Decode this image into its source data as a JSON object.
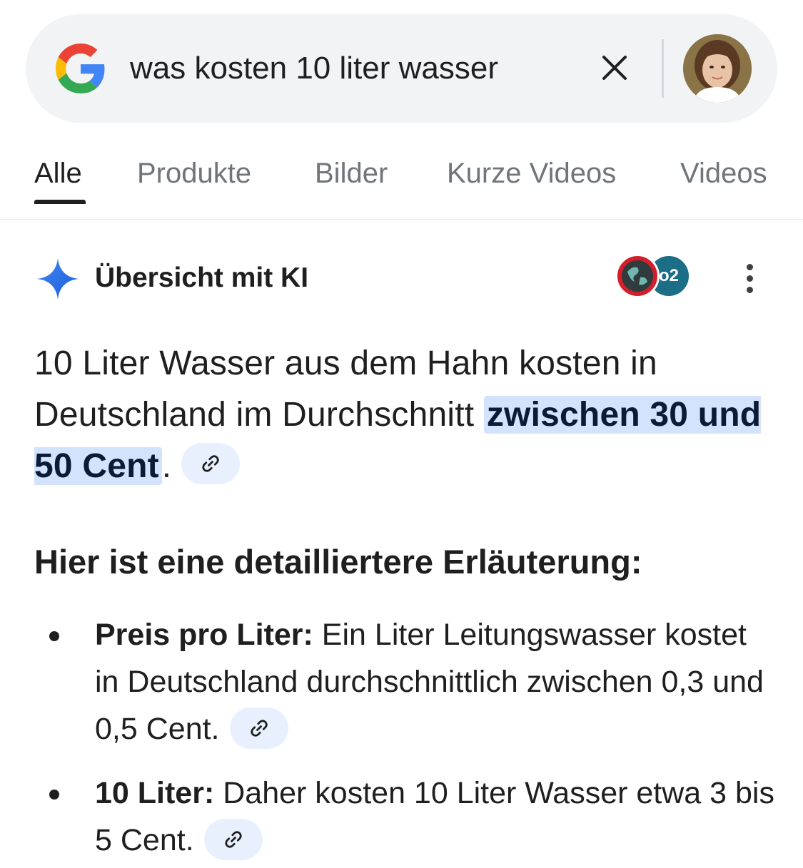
{
  "search": {
    "query": "was kosten 10 liter wasser"
  },
  "tabs": [
    {
      "label": "Alle",
      "active": true
    },
    {
      "label": "Produkte",
      "active": false
    },
    {
      "label": "Bilder",
      "active": false
    },
    {
      "label": "Kurze Videos",
      "active": false
    },
    {
      "label": "Videos",
      "active": false
    }
  ],
  "ai_overview": {
    "title": "Übersicht mit KI",
    "sources": [
      {
        "icon": "globe-icon",
        "color": "#d21f2b"
      },
      {
        "label": "o2",
        "color": "#1b6e86"
      }
    ],
    "answer": {
      "text_before": "10 Liter Wasser aus dem Hahn kosten in Deutschland im Durchschnitt ",
      "highlight": "zwischen 30 und 50 Cent",
      "text_after": "."
    },
    "heading": "Hier ist eine detailliertere Erläuterung:",
    "bullets": [
      {
        "label": "Preis pro Liter:",
        "text": " Ein Liter Leitungswasser kostet in Deutschland durchschnittlich zwischen 0,3 und 0,5 Cent."
      },
      {
        "label": "10 Liter:",
        "text": " Daher kosten 10 Liter Wasser etwa 3 bis 5 Cent."
      }
    ]
  },
  "colors": {
    "searchbar_bg": "#f1f3f4",
    "highlight_bg": "#d3e3fd",
    "chip_bg": "#e8f0fe",
    "sparkle": "#1a73e8"
  }
}
